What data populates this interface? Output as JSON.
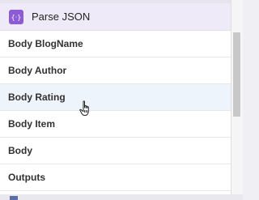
{
  "header": {
    "title": "Parse JSON",
    "icon": "parse-json-icon",
    "accent_color": "#8c5bd6"
  },
  "rows": [
    {
      "label": "Body BlogName"
    },
    {
      "label": "Body Author"
    },
    {
      "label": "Body Rating"
    },
    {
      "label": "Body Item"
    },
    {
      "label": "Body"
    },
    {
      "label": "Outputs"
    }
  ],
  "hover_row": "Body Rating",
  "cursor": "hand-pointer-icon"
}
